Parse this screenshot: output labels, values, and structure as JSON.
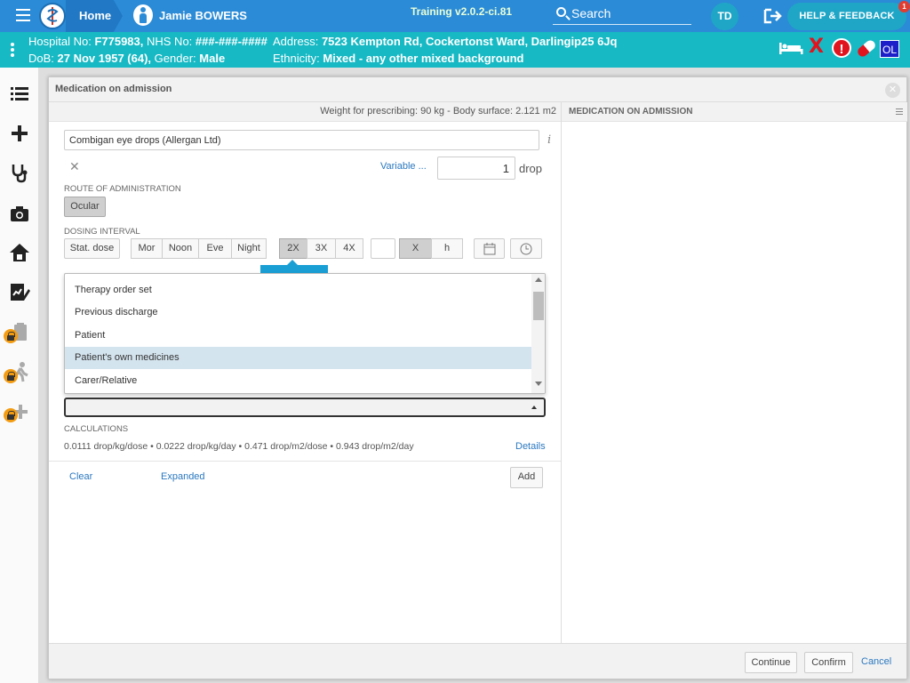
{
  "topbar": {
    "home_label": "Home",
    "patient_name": "Jamie BOWERS",
    "training_label": "Training v2.0.2-ci.81",
    "search_label": "Search",
    "user_initials": "TD",
    "help_label": "HELP & FEEDBACK",
    "help_badge": "1",
    "accent_color": "#2b8bd6"
  },
  "banner": {
    "hospital_no_label": "Hospital No:",
    "hospital_no": "F775983,",
    "nhs_label": "NHS No:",
    "nhs_no": "###-###-####",
    "address_label": "Address:",
    "address": "7523 Kempton Rd, Cockertonst Ward, Darlingip25 6Jq",
    "dob_label": "DoB:",
    "dob": "27 Nov 1957 (64),",
    "gender_label": "Gender:",
    "gender": "Male",
    "ethnicity_label": "Ethnicity:",
    "ethnicity": "Mixed - any other mixed background",
    "ol_badge": "OL",
    "x_mark": "X",
    "alert_mark": "!",
    "color": "#17b9c4"
  },
  "modal": {
    "title": "Medication on admission",
    "weight_text": "Weight for prescribing: 90 kg - Body surface: 2.121 m2",
    "right_title": "MEDICATION ON ADMISSION",
    "drug": "Combigan eye drops (Allergan Ltd)",
    "variable_label": "Variable ...",
    "dose_value": "1",
    "dose_unit": "drop",
    "route_label": "ROUTE OF ADMINISTRATION",
    "route_value": "Ocular",
    "dosing_label": "DOSING INTERVAL",
    "stat_dose": "Stat. dose",
    "times": [
      "Mor",
      "Noon",
      "Eve",
      "Night"
    ],
    "frequency": [
      "2X",
      "3X",
      "4X"
    ],
    "freq_x": "X",
    "freq_h": "h",
    "dropdown_items": [
      "Therapy order set",
      "Previous discharge",
      "Patient",
      "Patient's own medicines",
      "Carer/Relative"
    ],
    "calc_label": "CALCULATIONS",
    "calc_text": "0.0111 drop/kg/dose • 0.0222 drop/kg/day • 0.471 drop/m2/dose • 0.943 drop/m2/day",
    "details_label": "Details",
    "clear_label": "Clear",
    "expanded_label": "Expanded",
    "add_label": "Add",
    "continue_label": "Continue",
    "confirm_label": "Confirm",
    "cancel_label": "Cancel"
  },
  "icons": {
    "rail": [
      "list-icon",
      "plus-icon",
      "stethoscope-icon",
      "camera-icon",
      "home-icon",
      "chart-edit-icon",
      "clipboard-locked-icon",
      "walk-locked-icon",
      "plus-locked-icon"
    ]
  }
}
